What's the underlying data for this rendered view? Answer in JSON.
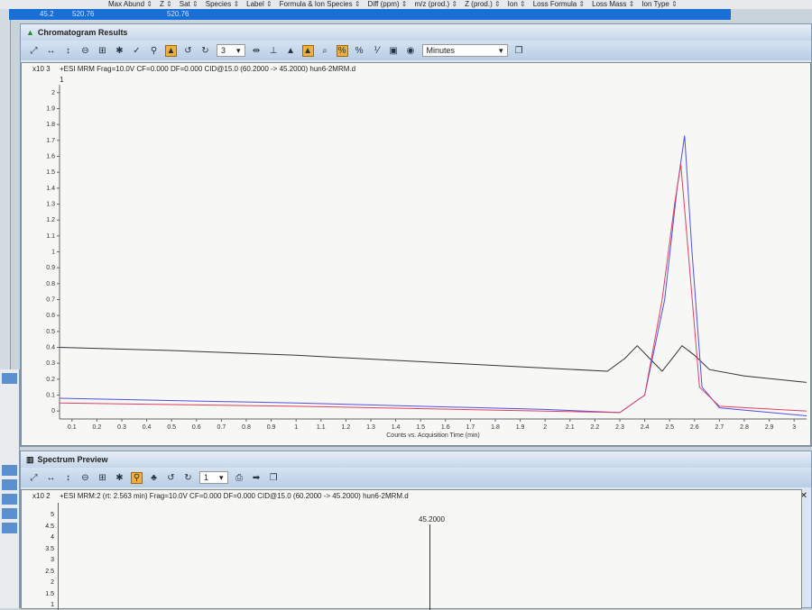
{
  "table_header": [
    "Max Abund",
    "Z",
    "Sat",
    "Species",
    "Label",
    "Formula & Ion Species",
    "Diff (ppm)",
    "m/z (prod.)",
    "Z (prod.)",
    "Ion",
    "Loss Formula",
    "Loss Mass",
    "Ion Type"
  ],
  "selected_row": {
    "c1": "45.2",
    "c2": "520.76",
    "c3": "520.76"
  },
  "chromatogram": {
    "title": "Chromatogram Results",
    "toolbar_num": "3",
    "units": "Minutes",
    "trace_label": "+ESI MRM Frag=10.0V CF=0.000 DF=0.000 CID@15.0 (60.2000 -> 45.2000) hun6-2MRM.d",
    "trace_index": "1",
    "multiplier": "x10 3"
  },
  "spectrum": {
    "title": "Spectrum Preview",
    "toolbar_num": "1",
    "trace_label": "+ESI MRM:2 (rt: 2.563 min) Frag=10.0V CF=0.000 DF=0.000 CID@15.0 (60.2000 -> 45.2000) hun6-2MRM.d",
    "multiplier": "x10 2",
    "peak_label": "45.2000",
    "yticks": [
      "5",
      "4.5",
      "4",
      "3.5",
      "3",
      "2.5",
      "2",
      "1.5",
      "1"
    ]
  },
  "chart_data": {
    "type": "line",
    "xlabel": "Counts vs. Acquisition Time (min)",
    "ylabel": "",
    "xlim": [
      0.05,
      3.05
    ],
    "ylim": [
      -0.05,
      2.05
    ],
    "xticks": [
      0.1,
      0.2,
      0.3,
      0.4,
      0.5,
      0.6,
      0.7,
      0.8,
      0.9,
      1,
      1.1,
      1.2,
      1.3,
      1.4,
      1.5,
      1.6,
      1.7,
      1.8,
      1.9,
      2,
      2.1,
      2.2,
      2.3,
      2.4,
      2.5,
      2.6,
      2.7,
      2.8,
      2.9,
      3
    ],
    "yticks": [
      0,
      0.1,
      0.2,
      0.3,
      0.4,
      0.5,
      0.6,
      0.7,
      0.8,
      0.9,
      1,
      1.1,
      1.2,
      1.3,
      1.4,
      1.5,
      1.6,
      1.7,
      1.8,
      1.9,
      2
    ],
    "series": [
      {
        "name": "black",
        "color": "#333333",
        "x": [
          0.05,
          0.5,
          1.0,
          1.5,
          2.0,
          2.25,
          2.32,
          2.37,
          2.42,
          2.47,
          2.51,
          2.55,
          2.6,
          2.66,
          2.8,
          3.05
        ],
        "y": [
          0.4,
          0.38,
          0.35,
          0.31,
          0.27,
          0.25,
          0.33,
          0.41,
          0.33,
          0.25,
          0.33,
          0.41,
          0.35,
          0.26,
          0.22,
          0.18
        ]
      },
      {
        "name": "blue",
        "color": "#5050e0",
        "x": [
          0.05,
          1.0,
          2.0,
          2.3,
          2.4,
          2.48,
          2.53,
          2.56,
          2.59,
          2.63,
          2.7,
          3.05
        ],
        "y": [
          0.08,
          0.05,
          0.01,
          -0.01,
          0.1,
          0.7,
          1.4,
          1.73,
          1.0,
          0.15,
          0.02,
          -0.03
        ]
      },
      {
        "name": "red",
        "color": "#e04060",
        "x": [
          0.05,
          1.0,
          2.0,
          2.3,
          2.4,
          2.47,
          2.52,
          2.545,
          2.58,
          2.62,
          2.7,
          3.05
        ],
        "y": [
          0.05,
          0.03,
          0.0,
          -0.01,
          0.1,
          0.7,
          1.3,
          1.55,
          0.9,
          0.15,
          0.03,
          0.0
        ]
      }
    ]
  }
}
